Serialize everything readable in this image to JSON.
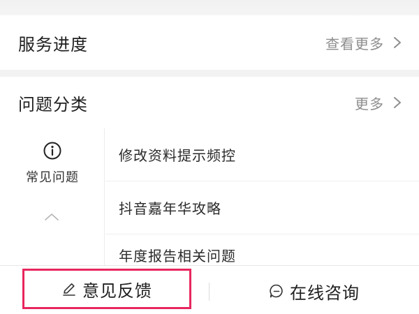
{
  "service": {
    "title": "服务进度",
    "more_label": "查看更多"
  },
  "category": {
    "title": "问题分类",
    "more_label": "更多",
    "sidebar": {
      "active_tab_label": "常见问题"
    },
    "questions": [
      "修改资料提示频控",
      "抖音嘉年华攻略",
      "年度报告相关问题"
    ]
  },
  "bottom_bar": {
    "feedback_label": "意见反馈",
    "consult_label": "在线咨询",
    "highlight_color": "#e8265e"
  },
  "icons": {
    "more": "chevron-right-icon",
    "faq": "info-icon",
    "collapse": "chevron-up-icon",
    "feedback": "pencil-icon",
    "consult": "chat-bubble-icon"
  }
}
